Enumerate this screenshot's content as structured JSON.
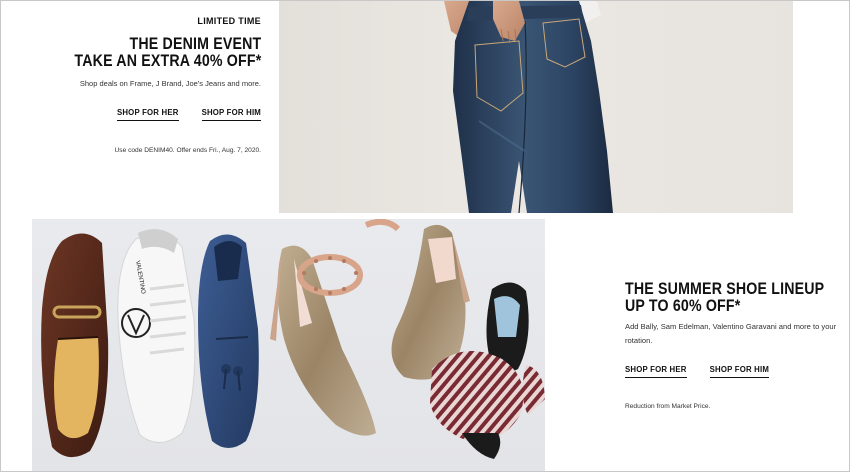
{
  "denim": {
    "eyebrow": "LIMITED TIME",
    "headline_1": "THE DENIM EVENT",
    "headline_2": "TAKE AN EXTRA 40% OFF*",
    "subtext": "Shop deals on Frame, J Brand, Joe's Jeans and more.",
    "cta_her": "SHOP FOR HER",
    "cta_him": "SHOP FOR HIM",
    "fineprint": "Use code DENIM40. Offer ends Fri., Aug. 7, 2020."
  },
  "shoes": {
    "headline_1": "THE SUMMER SHOE LINEUP",
    "headline_2": "UP TO 60% OFF*",
    "subtext": "Add Bally, Sam Edelman, Valentino Garavani and more to your rotation.",
    "cta_her": "SHOP FOR HER",
    "cta_him": "SHOP FOR HIM",
    "fineprint": "Reduction from Market Price.",
    "sneaker_text": "VALENTINO"
  },
  "colors": {
    "text": "#111111",
    "denim_blue": "#2b3f58",
    "backdrop": "#e6e2dd",
    "loafer_brown": "#5b2c1f",
    "suede_navy": "#2e4a79",
    "glitter_gold": "#a58f70",
    "stripe_red": "#7a2a32"
  }
}
